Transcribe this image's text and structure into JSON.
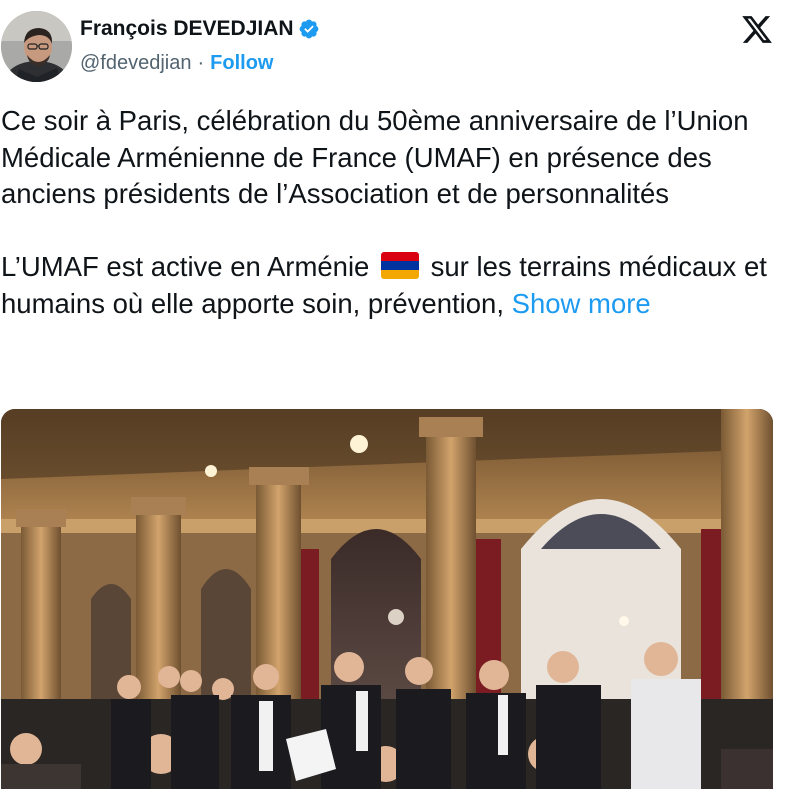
{
  "author": {
    "name": "François DEVEDJIAN",
    "handle": "@fdevedjian",
    "separator": "·",
    "follow_label": "Follow",
    "verified_color": "#1d9bf0"
  },
  "tweet": {
    "paragraph1": "Ce soir à Paris, célébration du 50ème anniversaire de l’Union Médicale Arménienne de France (UMAF) en présence des anciens présidents de l’Association et de personnalités",
    "paragraph2_before_flag": "L’UMAF est active en Arménie",
    "paragraph2_after_flag": "sur les terrains médicaux et humains où elle apporte soin, prévention,",
    "show_more": "Show more",
    "flag_colors": [
      "#d90012",
      "#0033a0",
      "#f2a800"
    ]
  },
  "colors": {
    "accent": "#1d9bf0",
    "text": "#0f1419",
    "secondary": "#536471"
  }
}
